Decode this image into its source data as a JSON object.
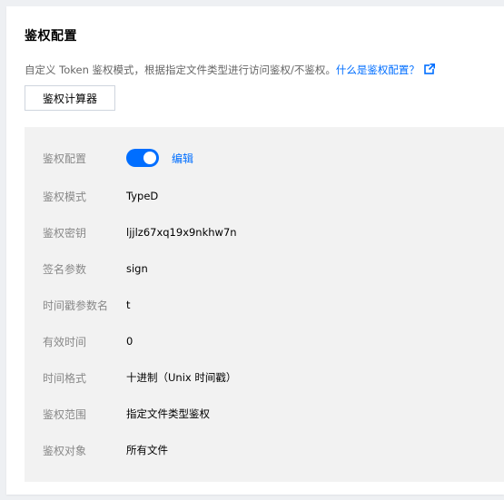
{
  "header": {
    "title": "鉴权配置"
  },
  "description": {
    "text": "自定义 Token 鉴权模式，根据指定文件类型进行访问鉴权/不鉴权。",
    "link_text": "什么是鉴权配置？",
    "link_icon": "external-link-icon"
  },
  "calculator_button": {
    "label": "鉴权计算器"
  },
  "config": {
    "auth_config": {
      "label": "鉴权配置",
      "toggle_on": true,
      "edit_label": "编辑"
    },
    "rows": [
      {
        "label": "鉴权模式",
        "value": "TypeD"
      },
      {
        "label": "鉴权密钥",
        "value": "ljjlz67xq19x9nkhw7n"
      },
      {
        "label": "签名参数",
        "value": "sign"
      },
      {
        "label": "时间戳参数名",
        "value": "t"
      },
      {
        "label": "有效时间",
        "value": "0"
      },
      {
        "label": "时间格式",
        "value": "十进制（Unix 时间戳）"
      },
      {
        "label": "鉴权范围",
        "value": "指定文件类型鉴权"
      },
      {
        "label": "鉴权对象",
        "value": "所有文件"
      }
    ]
  },
  "colors": {
    "accent": "#006eff",
    "panel_bg": "#f2f2f2",
    "label_text": "#888888"
  }
}
